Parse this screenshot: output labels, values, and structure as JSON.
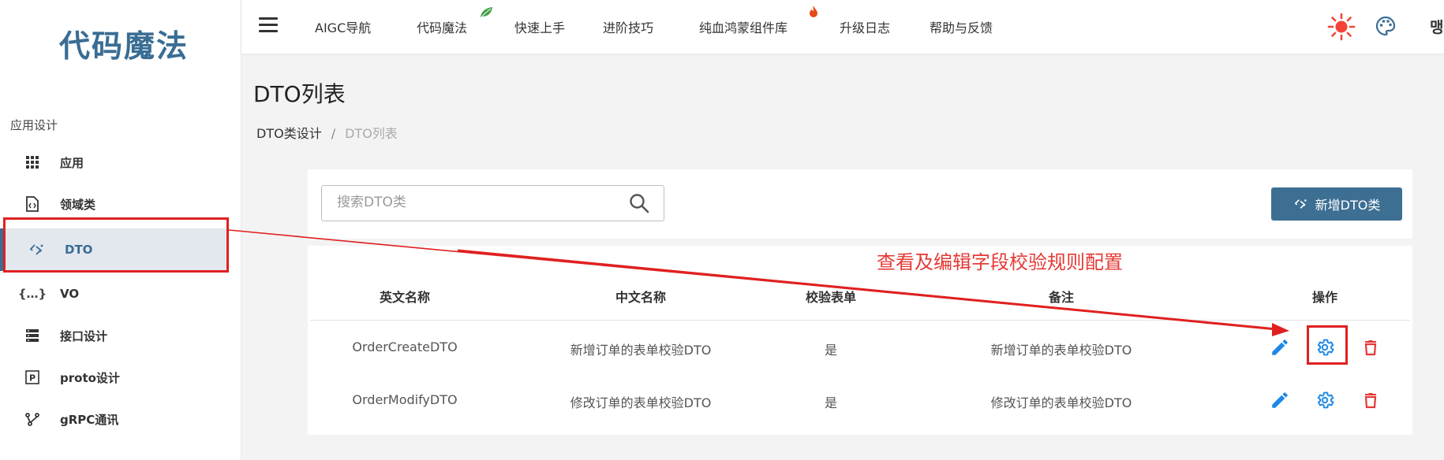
{
  "sidebar": {
    "logo": "代码魔法",
    "section_label": "应用设计",
    "items": [
      {
        "label": "应用",
        "icon": "grid-icon"
      },
      {
        "label": "领域类",
        "icon": "code-file-icon"
      },
      {
        "label": "DTO",
        "icon": "dto-transform-icon",
        "active": true
      },
      {
        "label": "VO",
        "icon": "curly-braces-icon"
      },
      {
        "label": "接口设计",
        "icon": "server-icon"
      },
      {
        "label": "proto设计",
        "icon": "proto-p-icon"
      },
      {
        "label": "gRPC通讯",
        "icon": "grpc-branch-icon"
      }
    ]
  },
  "topnav": {
    "items": [
      "AIGC导航",
      "代码魔法",
      "快速上手",
      "进阶技巧",
      "纯血鸿蒙组件库",
      "升级日志",
      "帮助与反馈"
    ],
    "truncated_right": "맹"
  },
  "page": {
    "title": "DTO列表",
    "breadcrumb": {
      "parent": "DTO类设计",
      "separator": "/",
      "current": "DTO列表"
    }
  },
  "search": {
    "placeholder": "搜索DTO类",
    "value": ""
  },
  "add_button_label": "新增DTO类",
  "annotation": "查看及编辑字段校验规则配置",
  "table": {
    "headers": [
      "英文名称",
      "中文名称",
      "校验表单",
      "备注",
      "操作"
    ],
    "rows": [
      [
        "OrderCreateDTO",
        "新增订单的表单校验DTO",
        "是",
        "新增订单的表单校验DTO"
      ],
      [
        "OrderModifyDTO",
        "修改订单的表单校验DTO",
        "是",
        "修改订单的表单校验DTO"
      ]
    ]
  },
  "colors": {
    "brand": "#3a6d94",
    "button": "#3d6f93",
    "edit_icon": "#1e88e5",
    "delete_icon": "#e53935",
    "annotation": "#e53935"
  }
}
